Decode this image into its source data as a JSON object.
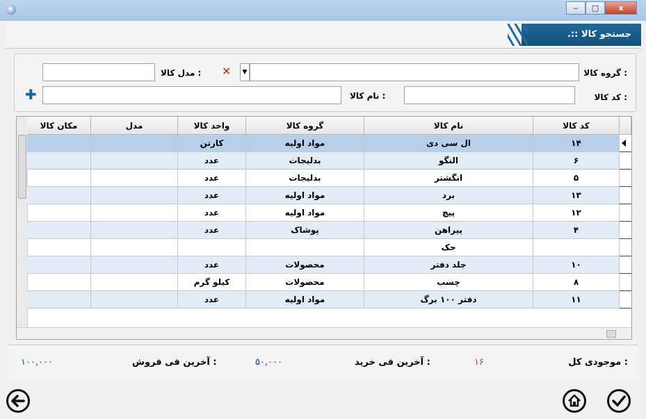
{
  "window": {
    "title": "",
    "minimize": "‒",
    "maximize": "□",
    "close": "x"
  },
  "header": {
    "title": ".:: جستجو کالا"
  },
  "search": {
    "group_label": "گروه کالا :",
    "model_label": "مدل کالا :",
    "code_label": "کد کالا :",
    "name_label": "نام کالا :",
    "group_value": "",
    "model_value": "",
    "code_value": "",
    "name_value": ""
  },
  "grid": {
    "columns": [
      "کد کالا",
      "نام کالا",
      "گروه کالا",
      "واحد کالا",
      "مدل",
      "مکان کالا"
    ],
    "rows": [
      {
        "code": "۱۴",
        "name": "ال سی دی",
        "group": "مواد اولیه",
        "unit": "کارتن",
        "model": "",
        "location": ""
      },
      {
        "code": "۶",
        "name": "النگو",
        "group": "بدلیجات",
        "unit": "عدد",
        "model": "",
        "location": ""
      },
      {
        "code": "۵",
        "name": "انگشتر",
        "group": "بدلیجات",
        "unit": "عدد",
        "model": "",
        "location": ""
      },
      {
        "code": "۱۳",
        "name": "برد",
        "group": "مواد اولیه",
        "unit": "عدد",
        "model": "",
        "location": ""
      },
      {
        "code": "۱۲",
        "name": "پیچ",
        "group": "مواد اولیه",
        "unit": "عدد",
        "model": "",
        "location": ""
      },
      {
        "code": "۴",
        "name": "پیراهن",
        "group": "پوشاک",
        "unit": "عدد",
        "model": "",
        "location": ""
      },
      {
        "code": "",
        "name": "جک",
        "group": "",
        "unit": "",
        "model": "",
        "location": ""
      },
      {
        "code": "۱۰",
        "name": "جلد دفتر",
        "group": "محصولات",
        "unit": "عدد",
        "model": "",
        "location": ""
      },
      {
        "code": "۸",
        "name": "چسب",
        "group": "محصولات",
        "unit": "کیلو گرم",
        "model": "",
        "location": ""
      },
      {
        "code": "۱۱",
        "name": "دفتر ۱۰۰ برگ",
        "group": "مواد اولیه",
        "unit": "عدد",
        "model": "",
        "location": ""
      }
    ]
  },
  "footer": {
    "stock_label": "موجودی کل :",
    "stock_value": "۱۶",
    "last_buy_label": "آخرین فی خرید :",
    "last_buy_value": "۵۰,۰۰۰",
    "last_sell_label": "آخرین فی فروش :",
    "last_sell_value": "۱۰۰,۰۰۰"
  },
  "icons": {
    "back": "arrow-left-icon",
    "home": "home-icon",
    "confirm": "check-icon",
    "add": "plus-icon",
    "clear": "x-icon"
  },
  "colors": {
    "header_bg": "#1e6a9c",
    "row_alt": "#e1ecf7",
    "row_selected": "#b8cfea",
    "value_blue": "#1a4c8b",
    "value_red": "#c0392b"
  }
}
